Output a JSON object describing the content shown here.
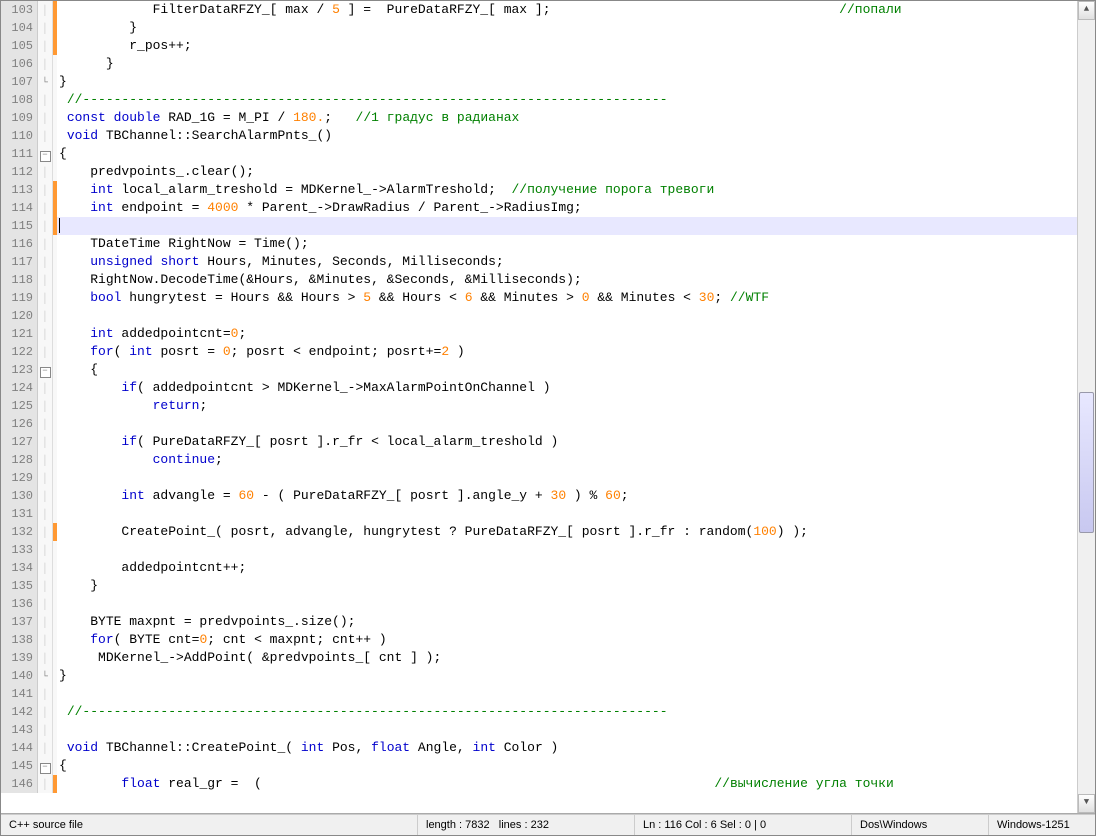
{
  "first_line_no": 103,
  "highlight_row": 13,
  "code_lines": [
    {
      "ind": 12,
      "change": true,
      "fold": "",
      "tokens": [
        {
          "t": "p",
          "v": "FilterDataRFZY_[ max / "
        },
        {
          "t": "num",
          "v": "5"
        },
        {
          "t": "p",
          "v": " ] =  PureDataRFZY_[ max ];"
        },
        {
          "t": "sp",
          "v": "                                     "
        },
        {
          "t": "cmt",
          "v": "//попали"
        }
      ]
    },
    {
      "ind": 9,
      "change": true,
      "fold": "",
      "tokens": [
        {
          "t": "p",
          "v": "}"
        }
      ]
    },
    {
      "ind": 9,
      "change": true,
      "fold": "",
      "tokens": [
        {
          "t": "p",
          "v": "r_pos++;"
        }
      ]
    },
    {
      "ind": 6,
      "change": false,
      "fold": "",
      "tokens": [
        {
          "t": "p",
          "v": "}"
        }
      ]
    },
    {
      "ind": 0,
      "change": false,
      "fold": "end",
      "tokens": [
        {
          "t": "p",
          "v": "}"
        }
      ]
    },
    {
      "ind": 1,
      "change": false,
      "fold": "",
      "tokens": [
        {
          "t": "cmt",
          "v": "//---------------------------------------------------------------------------"
        }
      ]
    },
    {
      "ind": 1,
      "change": false,
      "fold": "",
      "tokens": [
        {
          "t": "kw",
          "v": "const"
        },
        {
          "t": "p",
          "v": " "
        },
        {
          "t": "kw",
          "v": "double"
        },
        {
          "t": "p",
          "v": " RAD_1G = M_PI / "
        },
        {
          "t": "num",
          "v": "180."
        },
        {
          "t": "p",
          "v": ";   "
        },
        {
          "t": "cmt",
          "v": "//1 градус в радианах"
        }
      ]
    },
    {
      "ind": 1,
      "change": false,
      "fold": "",
      "tokens": [
        {
          "t": "kw",
          "v": "void"
        },
        {
          "t": "p",
          "v": " TBChannel::SearchAlarmPnts_()"
        }
      ]
    },
    {
      "ind": 0,
      "change": false,
      "fold": "minus",
      "tokens": [
        {
          "t": "p",
          "v": "{"
        }
      ]
    },
    {
      "ind": 4,
      "change": false,
      "fold": "",
      "tokens": [
        {
          "t": "p",
          "v": "predvpoints_.clear();"
        }
      ]
    },
    {
      "ind": 4,
      "change": true,
      "fold": "",
      "tokens": [
        {
          "t": "kw",
          "v": "int"
        },
        {
          "t": "p",
          "v": " local_alarm_treshold = MDKernel_->AlarmTreshold;  "
        },
        {
          "t": "cmt",
          "v": "//получение порога тревоги"
        }
      ]
    },
    {
      "ind": 4,
      "change": true,
      "fold": "",
      "tokens": [
        {
          "t": "kw",
          "v": "int"
        },
        {
          "t": "p",
          "v": " endpoint = "
        },
        {
          "t": "num",
          "v": "4000"
        },
        {
          "t": "p",
          "v": " * Parent_->DrawRadius / Parent_->RadiusImg;"
        }
      ]
    },
    {
      "ind": 4,
      "change": true,
      "fold": "",
      "tokens": []
    },
    {
      "ind": 4,
      "change": false,
      "fold": "",
      "tokens": [
        {
          "t": "p",
          "v": "TDateTime RightNow = Time();"
        }
      ]
    },
    {
      "ind": 4,
      "change": false,
      "fold": "",
      "tokens": [
        {
          "t": "kw",
          "v": "unsigned"
        },
        {
          "t": "p",
          "v": " "
        },
        {
          "t": "kw",
          "v": "short"
        },
        {
          "t": "p",
          "v": " Hours, Minutes, Seconds, Milliseconds;"
        }
      ]
    },
    {
      "ind": 4,
      "change": false,
      "fold": "",
      "tokens": [
        {
          "t": "p",
          "v": "RightNow.DecodeTime(&Hours, &Minutes, &Seconds, &Milliseconds);"
        }
      ]
    },
    {
      "ind": 4,
      "change": false,
      "fold": "",
      "tokens": [
        {
          "t": "kw",
          "v": "bool"
        },
        {
          "t": "p",
          "v": " hungrytest = Hours && Hours > "
        },
        {
          "t": "num",
          "v": "5"
        },
        {
          "t": "p",
          "v": " && Hours < "
        },
        {
          "t": "num",
          "v": "6"
        },
        {
          "t": "p",
          "v": " && Minutes > "
        },
        {
          "t": "num",
          "v": "0"
        },
        {
          "t": "p",
          "v": " && Minutes < "
        },
        {
          "t": "num",
          "v": "30"
        },
        {
          "t": "p",
          "v": "; "
        },
        {
          "t": "cmt",
          "v": "//WTF"
        }
      ]
    },
    {
      "ind": 0,
      "change": false,
      "fold": "",
      "tokens": []
    },
    {
      "ind": 4,
      "change": false,
      "fold": "",
      "tokens": [
        {
          "t": "kw",
          "v": "int"
        },
        {
          "t": "p",
          "v": " addedpointcnt="
        },
        {
          "t": "num",
          "v": "0"
        },
        {
          "t": "p",
          "v": ";"
        }
      ]
    },
    {
      "ind": 4,
      "change": false,
      "fold": "",
      "tokens": [
        {
          "t": "kw",
          "v": "for"
        },
        {
          "t": "p",
          "v": "( "
        },
        {
          "t": "kw",
          "v": "int"
        },
        {
          "t": "p",
          "v": " posrt = "
        },
        {
          "t": "num",
          "v": "0"
        },
        {
          "t": "p",
          "v": "; posrt < endpoint; posrt+="
        },
        {
          "t": "num",
          "v": "2"
        },
        {
          "t": "p",
          "v": " )"
        }
      ]
    },
    {
      "ind": 4,
      "change": false,
      "fold": "minus",
      "tokens": [
        {
          "t": "p",
          "v": "{"
        }
      ]
    },
    {
      "ind": 8,
      "change": false,
      "fold": "",
      "tokens": [
        {
          "t": "kw",
          "v": "if"
        },
        {
          "t": "p",
          "v": "( addedpointcnt > MDKernel_->MaxAlarmPointOnChannel )"
        }
      ]
    },
    {
      "ind": 12,
      "change": false,
      "fold": "",
      "tokens": [
        {
          "t": "kw",
          "v": "return"
        },
        {
          "t": "p",
          "v": ";"
        }
      ]
    },
    {
      "ind": 0,
      "change": false,
      "fold": "",
      "tokens": []
    },
    {
      "ind": 8,
      "change": false,
      "fold": "",
      "tokens": [
        {
          "t": "kw",
          "v": "if"
        },
        {
          "t": "p",
          "v": "( PureDataRFZY_[ posrt ].r_fr < local_alarm_treshold )"
        }
      ]
    },
    {
      "ind": 12,
      "change": false,
      "fold": "",
      "tokens": [
        {
          "t": "kw",
          "v": "continue"
        },
        {
          "t": "p",
          "v": ";"
        }
      ]
    },
    {
      "ind": 0,
      "change": false,
      "fold": "",
      "tokens": []
    },
    {
      "ind": 8,
      "change": false,
      "fold": "",
      "tokens": [
        {
          "t": "kw",
          "v": "int"
        },
        {
          "t": "p",
          "v": " advangle = "
        },
        {
          "t": "num",
          "v": "60"
        },
        {
          "t": "p",
          "v": " - ( PureDataRFZY_[ posrt ].angle_y + "
        },
        {
          "t": "num",
          "v": "30"
        },
        {
          "t": "p",
          "v": " ) % "
        },
        {
          "t": "num",
          "v": "60"
        },
        {
          "t": "p",
          "v": ";"
        }
      ]
    },
    {
      "ind": 0,
      "change": false,
      "fold": "",
      "tokens": []
    },
    {
      "ind": 8,
      "change": true,
      "fold": "",
      "tokens": [
        {
          "t": "p",
          "v": "CreatePoint_( posrt, advangle, hungrytest ? PureDataRFZY_[ posrt ].r_fr : random("
        },
        {
          "t": "num",
          "v": "100"
        },
        {
          "t": "p",
          "v": ") );"
        }
      ]
    },
    {
      "ind": 0,
      "change": false,
      "fold": "",
      "tokens": []
    },
    {
      "ind": 8,
      "change": false,
      "fold": "",
      "tokens": [
        {
          "t": "p",
          "v": "addedpointcnt++;"
        }
      ]
    },
    {
      "ind": 4,
      "change": false,
      "fold": "",
      "tokens": [
        {
          "t": "p",
          "v": "}"
        }
      ]
    },
    {
      "ind": 0,
      "change": false,
      "fold": "",
      "tokens": []
    },
    {
      "ind": 4,
      "change": false,
      "fold": "",
      "tokens": [
        {
          "t": "p",
          "v": "BYTE maxpnt = predvpoints_.size();"
        }
      ]
    },
    {
      "ind": 4,
      "change": false,
      "fold": "",
      "tokens": [
        {
          "t": "kw",
          "v": "for"
        },
        {
          "t": "p",
          "v": "( BYTE cnt="
        },
        {
          "t": "num",
          "v": "0"
        },
        {
          "t": "p",
          "v": "; cnt < maxpnt; cnt++ )"
        }
      ]
    },
    {
      "ind": 5,
      "change": false,
      "fold": "",
      "tokens": [
        {
          "t": "p",
          "v": "MDKernel_->AddPoint( &predvpoints_[ cnt ] );"
        }
      ]
    },
    {
      "ind": 0,
      "change": false,
      "fold": "end",
      "tokens": [
        {
          "t": "p",
          "v": "}"
        }
      ]
    },
    {
      "ind": 0,
      "change": false,
      "fold": "",
      "tokens": []
    },
    {
      "ind": 1,
      "change": false,
      "fold": "",
      "tokens": [
        {
          "t": "cmt",
          "v": "//---------------------------------------------------------------------------"
        }
      ]
    },
    {
      "ind": 0,
      "change": false,
      "fold": "",
      "tokens": []
    },
    {
      "ind": 1,
      "change": false,
      "fold": "",
      "tokens": [
        {
          "t": "kw",
          "v": "void"
        },
        {
          "t": "p",
          "v": " TBChannel::CreatePoint_( "
        },
        {
          "t": "kw",
          "v": "int"
        },
        {
          "t": "p",
          "v": " Pos, "
        },
        {
          "t": "kw",
          "v": "float"
        },
        {
          "t": "p",
          "v": " Angle, "
        },
        {
          "t": "kw",
          "v": "int"
        },
        {
          "t": "p",
          "v": " Color )"
        }
      ]
    },
    {
      "ind": 0,
      "change": false,
      "fold": "minus",
      "tokens": [
        {
          "t": "p",
          "v": "{"
        }
      ]
    },
    {
      "ind": 8,
      "change": true,
      "fold": "",
      "tokens": [
        {
          "t": "kw",
          "v": "float"
        },
        {
          "t": "p",
          "v": " real_gr =  ("
        },
        {
          "t": "sp",
          "v": "                                                          "
        },
        {
          "t": "cmt",
          "v": "//вычисление угла точки"
        }
      ]
    }
  ],
  "statusbar": {
    "type": "C++ source file",
    "length_label": "length : 7832",
    "lines_label": "lines : 232",
    "pos": "Ln : 116   Col : 6   Sel : 0 | 0",
    "eol": "Dos\\Windows",
    "encoding": "Windows-1251"
  }
}
